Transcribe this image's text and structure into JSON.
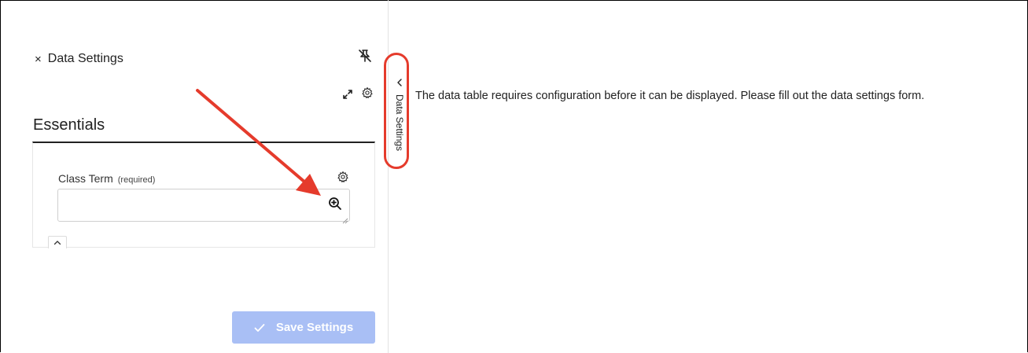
{
  "panel": {
    "title": "Data Settings",
    "close_glyph": "×",
    "icons": [
      "close-icon",
      "pin-off-icon",
      "expand-icon",
      "gear-icon"
    ]
  },
  "essentials": {
    "title": "Essentials",
    "field": {
      "label": "Class Term",
      "required_note": "(required)",
      "value": "",
      "placeholder": "",
      "icons": [
        "gear-icon",
        "zoom-in-icon"
      ]
    },
    "collapse_icon": "chevron-up-icon"
  },
  "save_button": {
    "label": "Save Settings",
    "icon": "check-icon",
    "color": "#a9bff5"
  },
  "side_tab": {
    "label": "Data Settings",
    "icon": "chevron-left-icon"
  },
  "main": {
    "message": "The data table requires configuration before it can be displayed. Please fill out the data settings form."
  },
  "annotation": {
    "color": "#e53b2c",
    "shapes": [
      "arrow",
      "rounded-rectangle"
    ]
  }
}
